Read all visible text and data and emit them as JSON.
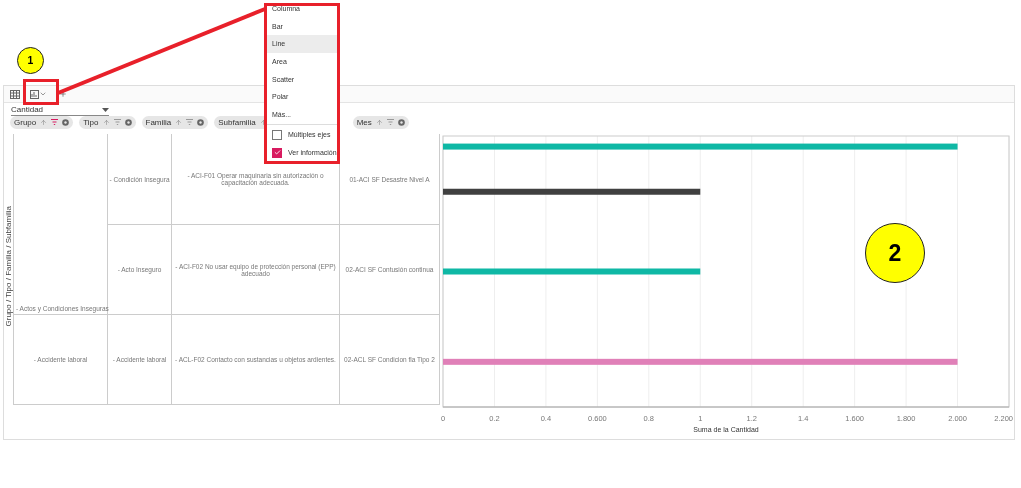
{
  "toolbar": {
    "measure": {
      "value": "Cantidad"
    }
  },
  "fields": [
    {
      "label": "Grupo",
      "filter_active": true
    },
    {
      "label": "Tipo",
      "filter_active": false
    },
    {
      "label": "Familia",
      "filter_active": false
    },
    {
      "label": "Subfamilia"
    },
    {
      "label": "Mes",
      "filter_active": false
    }
  ],
  "axis_title": "Grupo / Tipo / Familia / Subfamilia",
  "table": {
    "groups": [
      {
        "label": "- Actos y Condiciones Inseguras",
        "types": [
          {
            "label": "- Condición Insegura",
            "family": "- ACI-F01 Operar maquinaria sin autorización o capacitación adecuada.",
            "subfamily": "01-ACI SF Desastre Nivel A"
          },
          {
            "label": "- Acto Inseguro",
            "family": "- ACI-F02 No usar equipo de protección personal (EPP) adecuado",
            "subfamily": "02-ACI SF Contusión continua"
          }
        ]
      },
      {
        "label": "- Accidente laboral",
        "types": [
          {
            "label": "- Accidente laboral",
            "family": "- ACL-F02 Contacto con sustancias u objetos ardientes.",
            "subfamily": "02-ACL SF Condicion fla Tipo 2"
          }
        ]
      }
    ]
  },
  "chart": {
    "chart_data": {
      "type": "bar",
      "orientation": "horizontal",
      "xlabel": "Suma de la Cantidad",
      "grid": true,
      "series": [
        {
          "color": "#0fb8a5",
          "values": [
            2,
            1,
            null
          ]
        },
        {
          "color": "#404040",
          "values": [
            1,
            null,
            null
          ]
        },
        {
          "color": "#e080b8",
          "values": [
            null,
            null,
            2
          ]
        }
      ],
      "xlim": [
        0,
        2.2
      ],
      "xticks": [
        0,
        0.2,
        0.4,
        {
          "value": 0.6,
          "label": "0.600"
        },
        0.8,
        1,
        1.2,
        1.4,
        {
          "value": 1.6,
          "label": "1.600"
        },
        {
          "value": 1.8,
          "label": "1.800"
        },
        {
          "value": 2,
          "label": "2.000"
        },
        {
          "value": 2.2,
          "label": "2.200"
        }
      ]
    }
  },
  "chart_menu": {
    "items": [
      {
        "kind": "option",
        "label": "Columna",
        "selected": false
      },
      {
        "kind": "option",
        "label": "Bar",
        "selected": false
      },
      {
        "kind": "option",
        "label": "Line",
        "selected": true
      },
      {
        "kind": "option",
        "label": "Area",
        "selected": false
      },
      {
        "kind": "option",
        "label": "Scatter",
        "selected": false
      },
      {
        "kind": "option",
        "label": "Polar",
        "selected": false
      },
      {
        "kind": "option",
        "label": "Más...",
        "selected": false
      },
      {
        "kind": "checkbox",
        "label": "Múltiples ejes",
        "checked": false
      },
      {
        "kind": "checkbox",
        "label": "Ver información",
        "checked": true
      }
    ]
  },
  "annotations": [
    {
      "kind": "callout",
      "label": "1"
    },
    {
      "kind": "callout",
      "label": "2"
    }
  ]
}
